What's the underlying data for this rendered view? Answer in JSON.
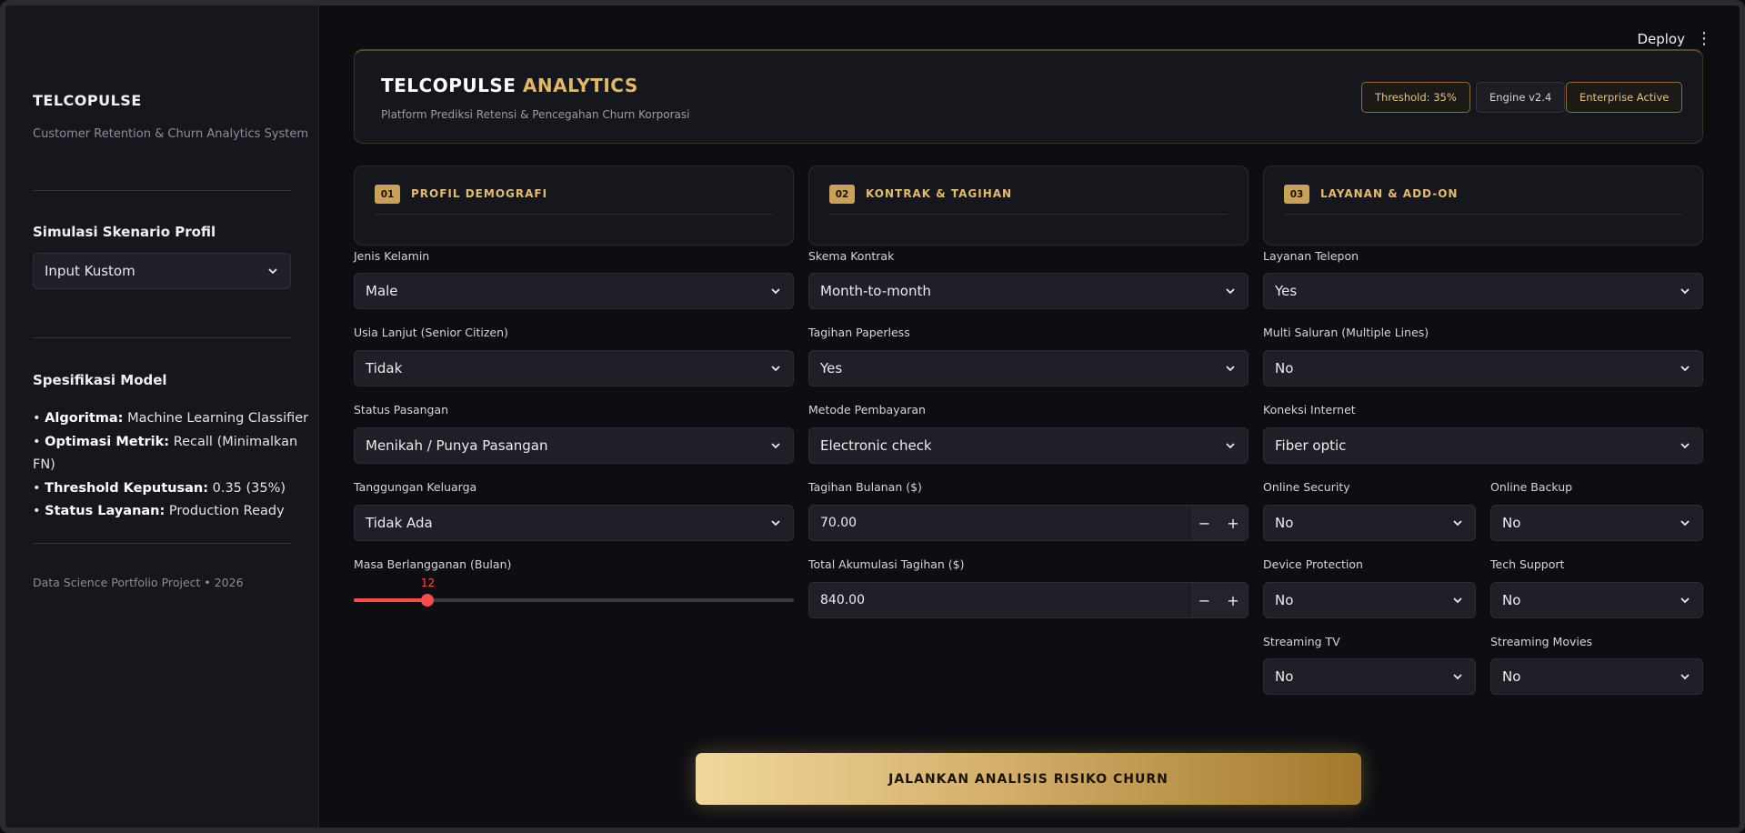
{
  "topbar": {
    "deploy_label": "Deploy",
    "menu_icon": "kebab-menu-icon"
  },
  "sidebar": {
    "title": "TELCOPULSE",
    "subtitle": "Customer Retention & Churn Analytics System",
    "scenario_heading": "Simulasi Skenario Profil",
    "scenario_value": "Input Kustom",
    "spec_heading": "Spesifikasi Model",
    "specs": [
      {
        "key": "Algoritma:",
        "value": "Machine Learning Classifier"
      },
      {
        "key": "Optimasi Metrik:",
        "value": "Recall (Minimalkan FN)"
      },
      {
        "key": "Threshold Keputusan:",
        "value": "0.35 (35%)"
      },
      {
        "key": "Status Layanan:",
        "value": "Production Ready"
      }
    ],
    "footer": "Data Science Portfolio Project • 2026"
  },
  "header": {
    "title_main": "TELCOPULSE",
    "title_accent": "ANALYTICS",
    "subtitle": "Platform Prediksi Retensi & Pencegahan Churn Korporasi",
    "badges": {
      "threshold": "Threshold: 35%",
      "engine": "Engine v2.4",
      "status": "Enterprise Active"
    }
  },
  "sections": [
    {
      "num": "01",
      "label": "PROFIL DEMOGRAFI"
    },
    {
      "num": "02",
      "label": "KONTRAK & TAGIHAN"
    },
    {
      "num": "03",
      "label": "LAYANAN & ADD-ON"
    }
  ],
  "demografi": {
    "gender_label": "Jenis Kelamin",
    "gender_value": "Male",
    "senior_label": "Usia Lanjut (Senior Citizen)",
    "senior_value": "Tidak",
    "partner_label": "Status Pasangan",
    "partner_value": "Menikah / Punya Pasangan",
    "dependents_label": "Tanggungan Keluarga",
    "dependents_value": "Tidak Ada",
    "tenure_label": "Masa Berlangganan (Bulan)",
    "tenure_value": "12",
    "tenure_fraction": 0.167
  },
  "kontrak": {
    "contract_label": "Skema Kontrak",
    "contract_value": "Month-to-month",
    "paperless_label": "Tagihan Paperless",
    "paperless_value": "Yes",
    "payment_label": "Metode Pembayaran",
    "payment_value": "Electronic check",
    "monthly_label": "Tagihan Bulanan ($)",
    "monthly_value": "70.00",
    "total_label": "Total Akumulasi Tagihan ($)",
    "total_value": "840.00",
    "minus": "−",
    "plus": "+"
  },
  "layanan": {
    "phone_label": "Layanan Telepon",
    "phone_value": "Yes",
    "multi_label": "Multi Saluran (Multiple Lines)",
    "multi_value": "No",
    "internet_label": "Koneksi Internet",
    "internet_value": "Fiber optic",
    "security_label": "Online Security",
    "security_value": "No",
    "backup_label": "Online Backup",
    "backup_value": "No",
    "protection_label": "Device Protection",
    "protection_value": "No",
    "support_label": "Tech Support",
    "support_value": "No",
    "tv_label": "Streaming TV",
    "tv_value": "No",
    "movies_label": "Streaming Movies",
    "movies_value": "No"
  },
  "run_button": "JALANKAN ANALISIS RISIKO CHURN",
  "colors": {
    "accent_gold": "#c9a257",
    "slider_red": "#ff4b4b",
    "background": "#0d0e12"
  }
}
